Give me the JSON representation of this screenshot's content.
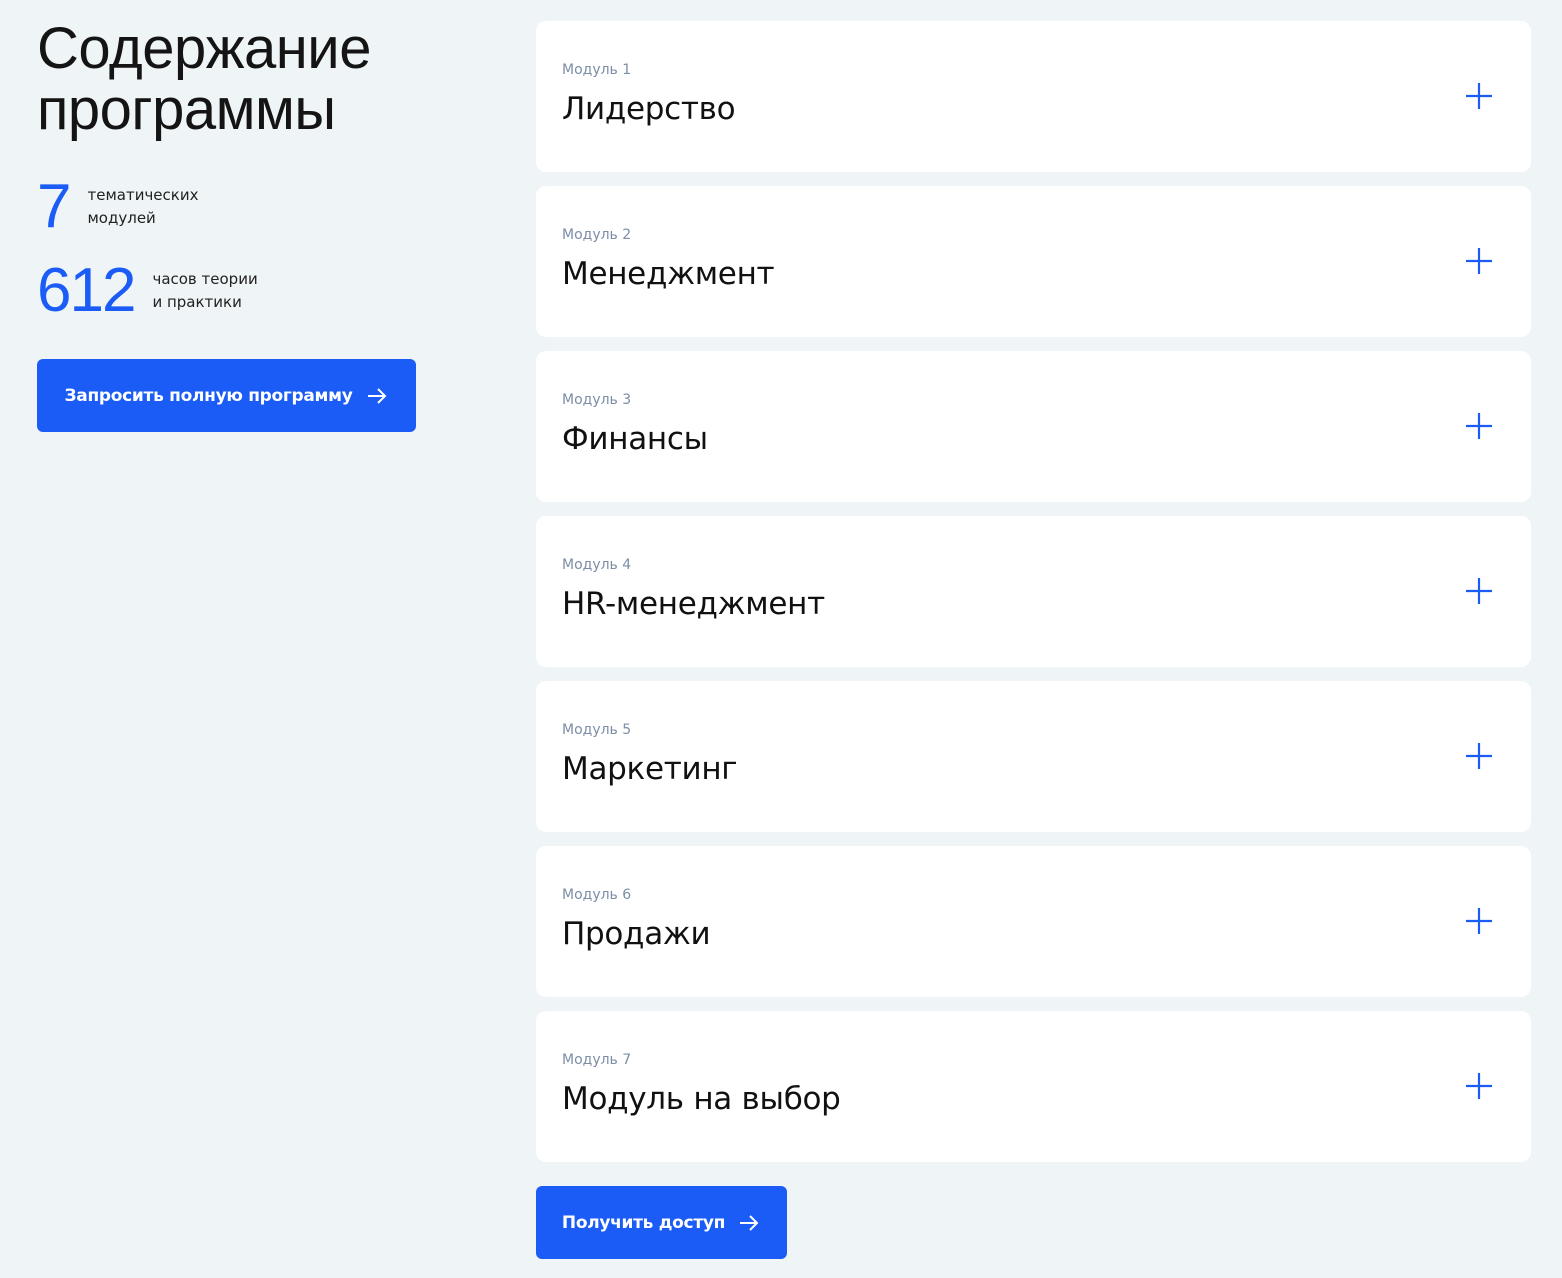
{
  "sidebar": {
    "title_line1": "Содержание",
    "title_line2": "программы",
    "stats": [
      {
        "number": "7",
        "text": "тематических\nмодулей"
      },
      {
        "number": "612",
        "text": "часов теории\nи практики"
      }
    ],
    "request_button_label": "Запросить полную программу"
  },
  "modules": [
    {
      "label": "Модуль 1",
      "title": "Лидерство"
    },
    {
      "label": "Модуль 2",
      "title": "Менеджмент"
    },
    {
      "label": "Модуль 3",
      "title": "Финансы"
    },
    {
      "label": "Модуль 4",
      "title": "HR-менеджмент"
    },
    {
      "label": "Модуль 5",
      "title": "Маркетинг"
    },
    {
      "label": "Модуль 6",
      "title": "Продажи"
    },
    {
      "label": "Модуль 7",
      "title": "Модуль на выбор"
    }
  ],
  "access_button_label": "Получить доступ",
  "colors": {
    "accent": "#1a5cf5",
    "background": "#eff4f6",
    "card": "#ffffff",
    "muted": "#7b8ea6"
  },
  "icons": {
    "expand": "plus-icon",
    "cta": "arrow-right-icon"
  }
}
